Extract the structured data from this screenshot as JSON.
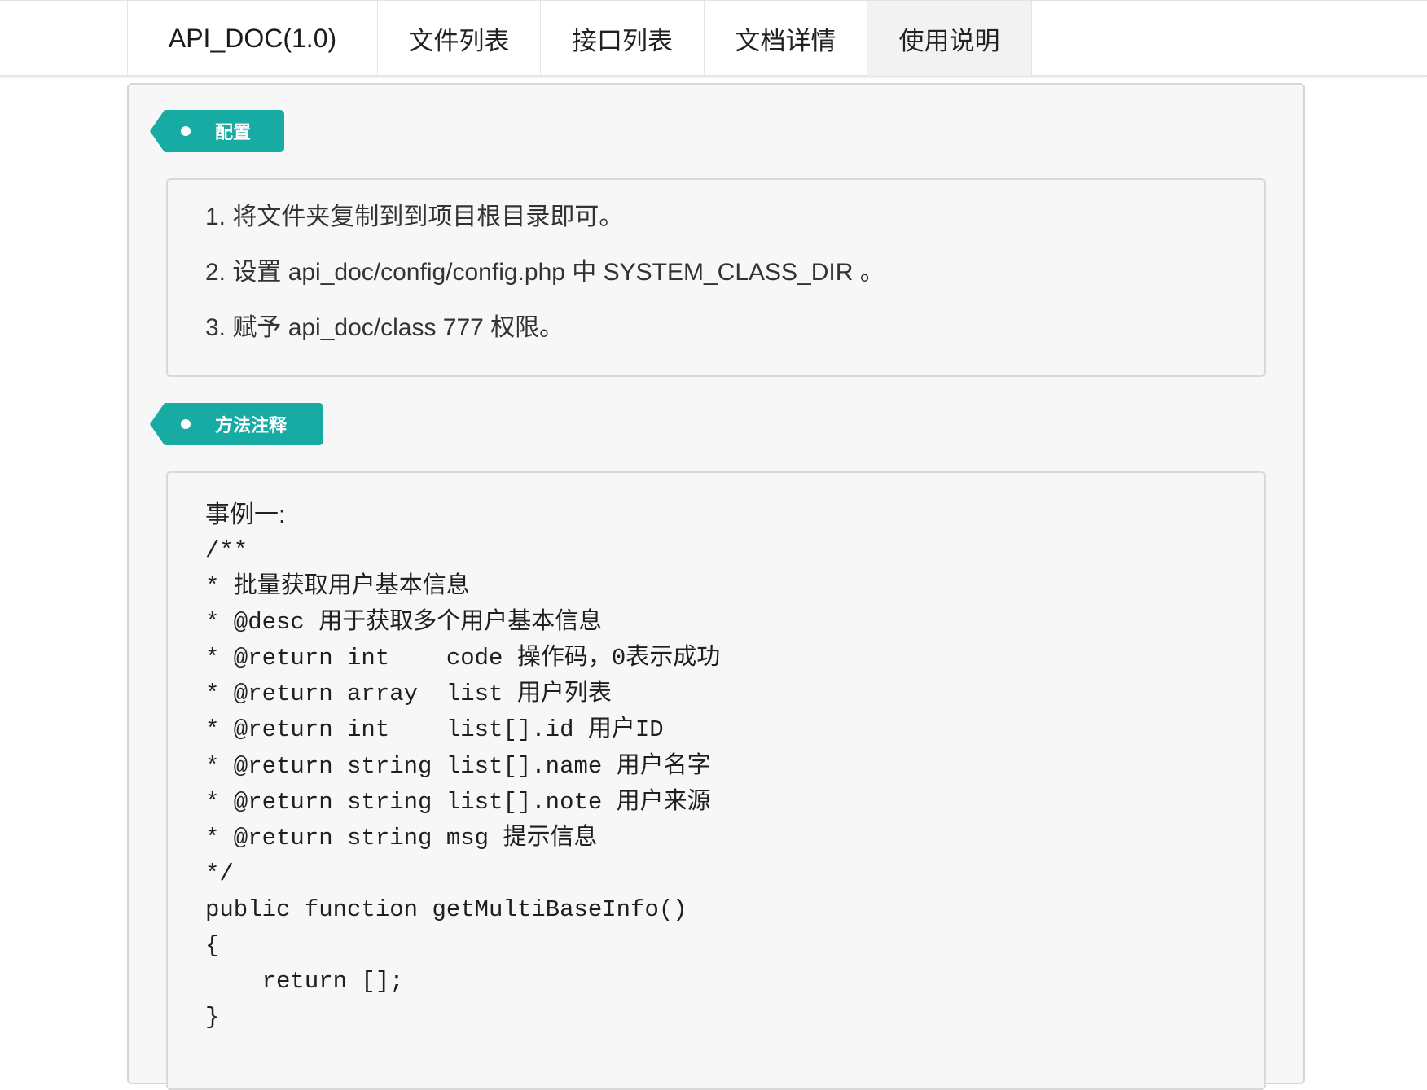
{
  "nav": {
    "brand": "API_DOC(1.0)",
    "items": [
      {
        "label": "文件列表"
      },
      {
        "label": "接口列表"
      },
      {
        "label": "文档详情"
      },
      {
        "label": "使用说明",
        "active": true
      }
    ]
  },
  "sections": {
    "config": {
      "title": "配置",
      "steps": [
        "1. 将文件夹复制到到项目根目录即可。",
        "2. 设置 api_doc/config/config.php 中 SYSTEM_CLASS_DIR 。",
        "3. 赋予 api_doc/class 777 权限。"
      ]
    },
    "method": {
      "title": "方法注释",
      "example_title": "事例一:",
      "code": [
        "/**",
        "* 批量获取用户基本信息",
        "* @desc 用于获取多个用户基本信息",
        "* @return int    code 操作码，0表示成功",
        "* @return array  list 用户列表",
        "* @return int    list[].id 用户ID",
        "* @return string list[].name 用户名字",
        "* @return string list[].note 用户来源",
        "* @return string msg 提示信息",
        "*/",
        "public function getMultiBaseInfo()",
        "{",
        "    return [];",
        "}"
      ]
    }
  },
  "colors": {
    "accent": "#17aba4",
    "panel_bg": "#f7f7f8",
    "border": "#d9d9d9"
  }
}
